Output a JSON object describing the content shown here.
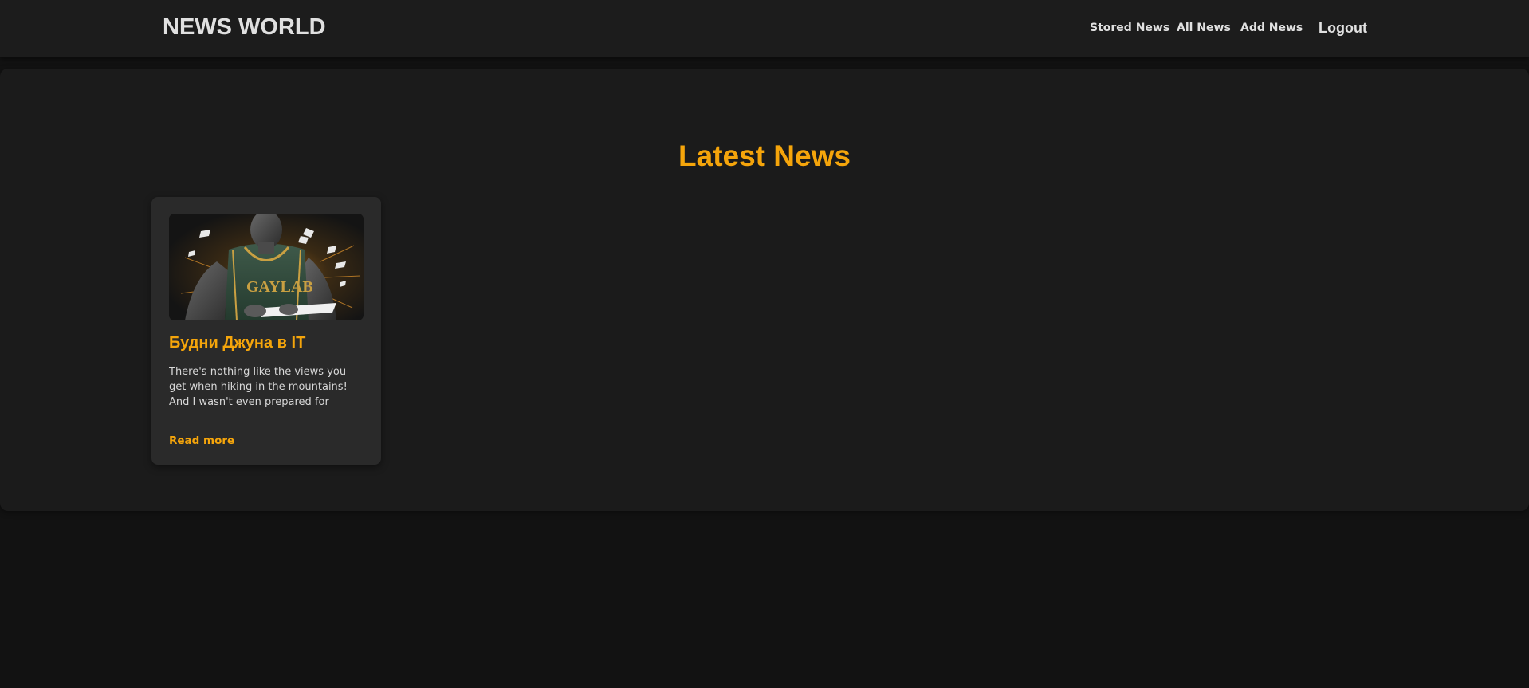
{
  "header": {
    "brand": "NEWS WORLD",
    "nav": {
      "stored_news": "Stored News",
      "all_news": "All News",
      "add_news": "Add News",
      "logout": "Logout"
    }
  },
  "main": {
    "section_title": "Latest News",
    "articles": [
      {
        "image_icon": "basketball-player-illustration",
        "title": "Будни Джуна в IT",
        "excerpt": "There's nothing like the views you get when hiking in the mountains! And I wasn't even prepared for",
        "read_more": "Read more"
      }
    ]
  },
  "colors": {
    "accent": "#f5a50b",
    "background": "#121212",
    "navbar": "#1c1c1c",
    "panel": "#1b1b1b",
    "card": "#2a2a2a",
    "text": "#e0e0e0"
  }
}
